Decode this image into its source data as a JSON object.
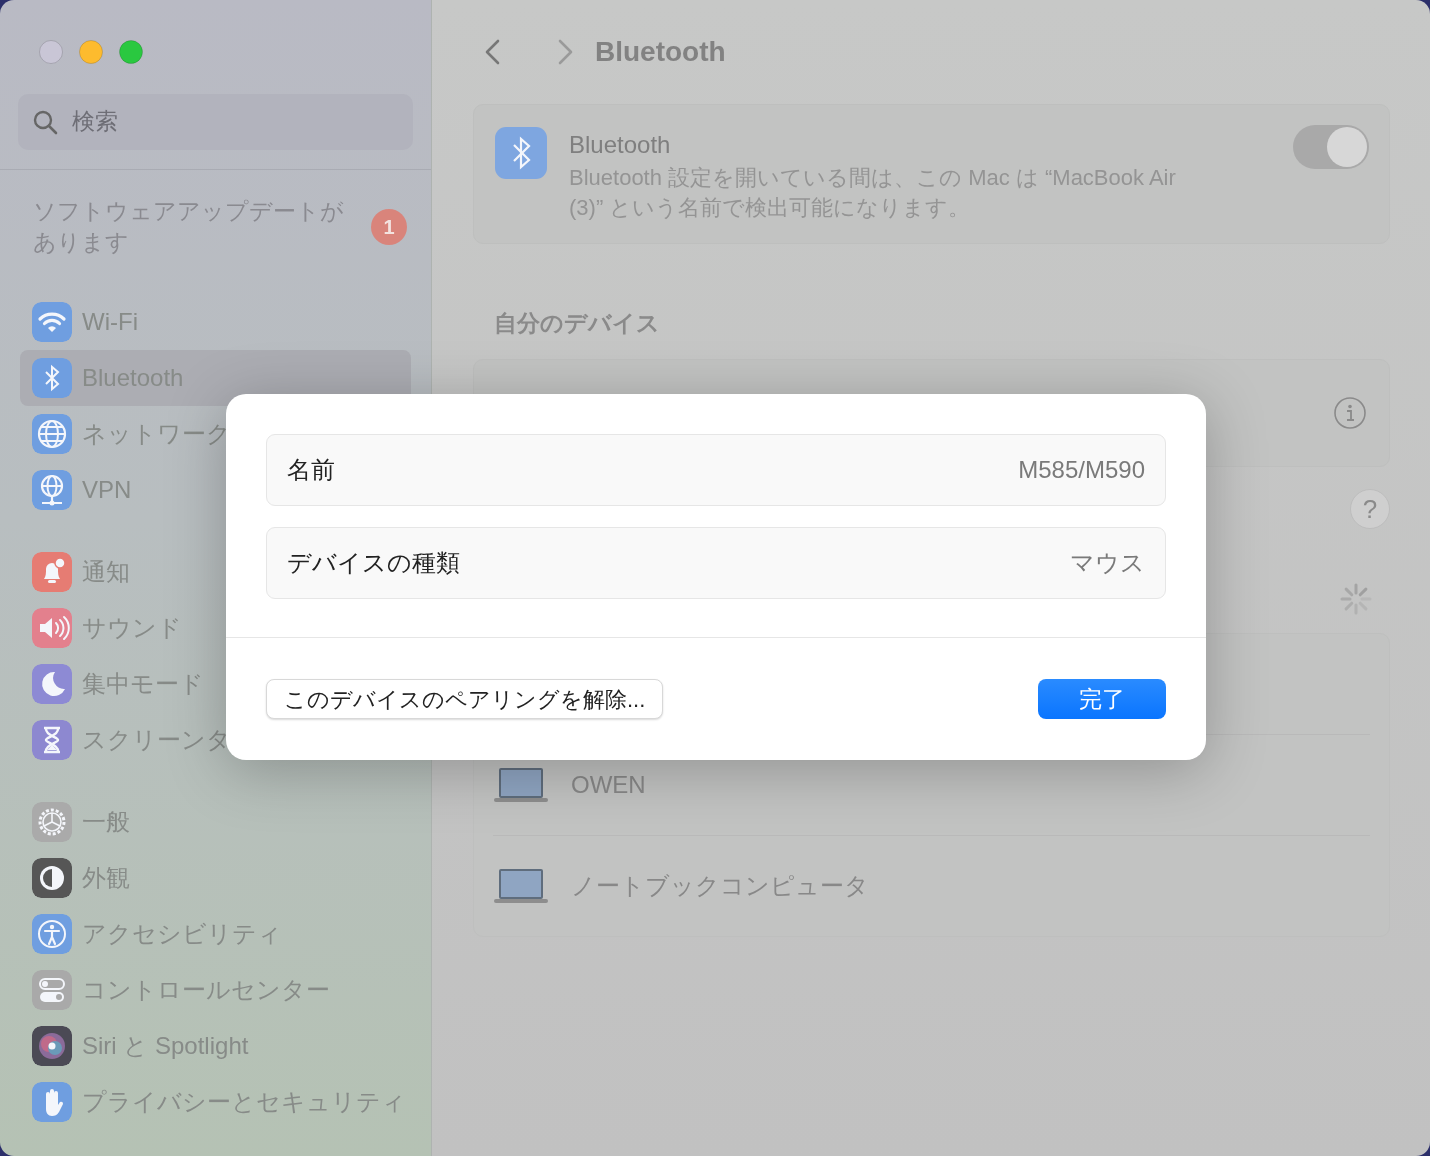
{
  "sidebar": {
    "search": {
      "placeholder": "検索"
    },
    "update_notice": {
      "text": "ソフトウェアアップデートがあります",
      "badge": "1"
    },
    "groups": [
      {
        "items": [
          {
            "label": "Wi-Fi",
            "selected": false
          },
          {
            "label": "Bluetooth",
            "selected": true
          },
          {
            "label": "ネットワーク",
            "selected": false
          },
          {
            "label": "VPN",
            "selected": false
          }
        ]
      },
      {
        "items": [
          {
            "label": "通知",
            "selected": false
          },
          {
            "label": "サウンド",
            "selected": false
          },
          {
            "label": "集中モード",
            "selected": false
          },
          {
            "label": "スクリーンタ",
            "selected": false
          }
        ]
      },
      {
        "items": [
          {
            "label": "一般",
            "selected": false
          },
          {
            "label": "外観",
            "selected": false
          },
          {
            "label": "アクセシビリティ",
            "selected": false
          },
          {
            "label": "コントロールセンター",
            "selected": false
          },
          {
            "label": "Siri と Spotlight",
            "selected": false
          },
          {
            "label": "プライバシーとセキュリティ",
            "selected": false
          }
        ]
      }
    ]
  },
  "header": {
    "title": "Bluetooth"
  },
  "bluetooth_card": {
    "title": "Bluetooth",
    "description": "Bluetooth 設定を開いている間は、この Mac は “MacBook Air (3)” という名前で検出可能になります。",
    "on": true
  },
  "my_devices": {
    "heading": "自分のデバイス",
    "help": "?"
  },
  "other_devices": {
    "rows": [
      {
        "name": "OWEN"
      },
      {
        "name": "ノートブックコンピュータ"
      }
    ]
  },
  "dialog": {
    "fields": [
      {
        "label": "名前",
        "value": "M585/M590"
      },
      {
        "label": "デバイスの種類",
        "value": "マウス"
      }
    ],
    "buttons": [
      {
        "label": "このデバイスのペアリングを解除...",
        "kind": "secondary"
      },
      {
        "label": "完了",
        "kind": "primary"
      }
    ]
  }
}
